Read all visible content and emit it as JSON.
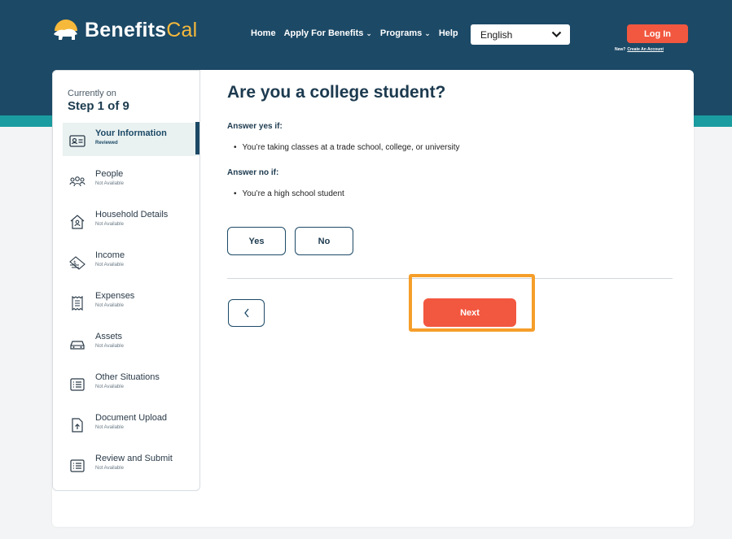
{
  "header": {
    "brand_main": "Benefits",
    "brand_accent": "Cal",
    "nav": [
      "Home",
      "Apply For Benefits",
      "Programs",
      "Help"
    ],
    "language": "English",
    "login_label": "Log In",
    "new_label": "New?",
    "create_account_label": "Create An Account"
  },
  "sidebar": {
    "currently_on": "Currently on",
    "step": "Step 1 of 9",
    "items": [
      {
        "label": "Your Information",
        "status": "Reviewed",
        "icon": "id-card-icon"
      },
      {
        "label": "People",
        "status": "Not Available",
        "icon": "people-icon"
      },
      {
        "label": "Household Details",
        "status": "Not Available",
        "icon": "house-icon"
      },
      {
        "label": "Income",
        "status": "Not Available",
        "icon": "money-icon"
      },
      {
        "label": "Expenses",
        "status": "Not Available",
        "icon": "receipt-icon"
      },
      {
        "label": "Assets",
        "status": "Not Available",
        "icon": "car-icon"
      },
      {
        "label": "Other Situations",
        "status": "Not Available",
        "icon": "list-icon"
      },
      {
        "label": "Document Upload",
        "status": "Not Available",
        "icon": "upload-icon"
      },
      {
        "label": "Review and Submit",
        "status": "Not Available",
        "icon": "list-icon"
      }
    ]
  },
  "main": {
    "title": "Are you a college student?",
    "yes_heading": "Answer yes if:",
    "yes_bullet": "You’re taking classes at a trade school, college, or university",
    "no_heading": "Answer no if:",
    "no_bullet": "You’re a high school student",
    "yes_button": "Yes",
    "no_button": "No",
    "next_button": "Next"
  },
  "colors": {
    "header_bg": "#1c4966",
    "teal_band": "#1a9ca0",
    "accent_red": "#f2573f",
    "brand_gold": "#f6b93b",
    "highlight_orange": "#f59e2a"
  }
}
